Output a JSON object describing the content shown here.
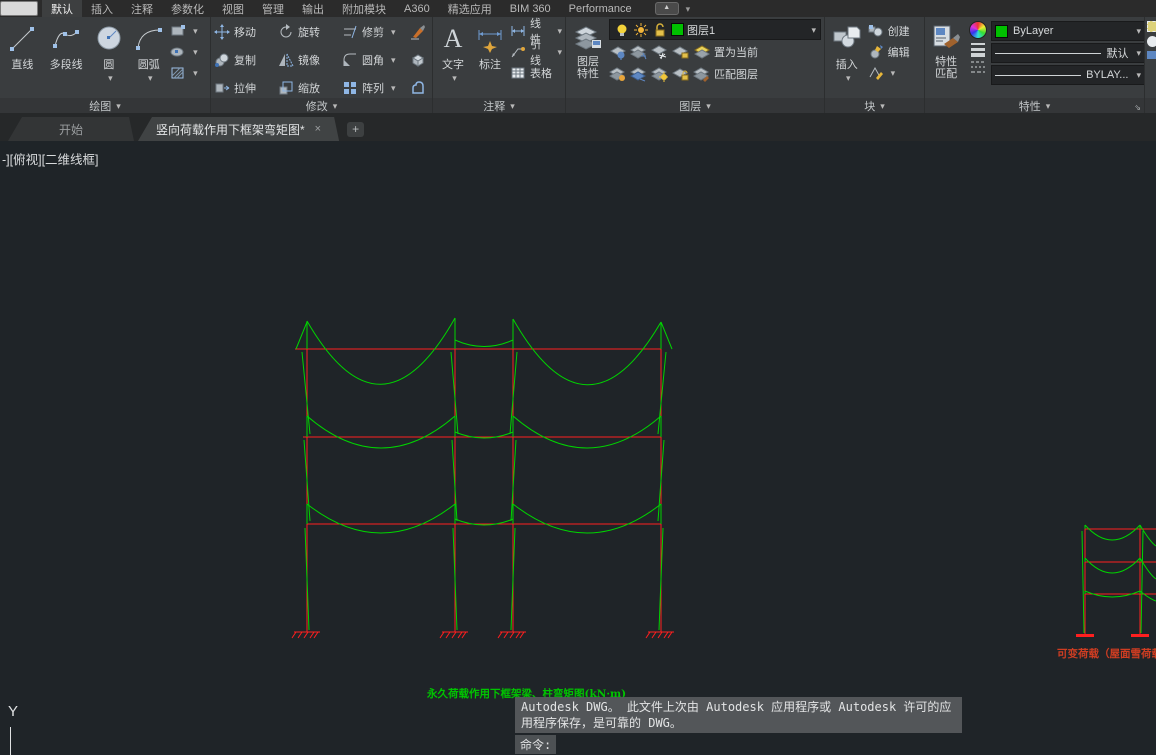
{
  "colors": {
    "canvas_bg": "#1f2428",
    "frame_red": "#ff1f1f",
    "moment_green": "#00d400",
    "bylayer_green": "#00c000",
    "caption_green": "#00c400",
    "caption_red": "#cf3d22"
  },
  "menu": {
    "tabs": [
      "默认",
      "插入",
      "注释",
      "参数化",
      "视图",
      "管理",
      "输出",
      "附加模块",
      "A360",
      "精选应用",
      "BIM 360",
      "Performance"
    ]
  },
  "ribbon": {
    "draw": {
      "title": "绘图",
      "line": "直线",
      "polyline": "多段线",
      "circle": "圆",
      "arc": "圆弧"
    },
    "modify": {
      "title": "修改",
      "move": "移动",
      "rotate": "旋转",
      "trim": "修剪",
      "copy": "复制",
      "mirror": "镜像",
      "fillet": "圆角",
      "stretch": "拉伸",
      "scale": "缩放",
      "array": "阵列"
    },
    "annotation": {
      "title": "注释",
      "text": "文字",
      "dimension": "标注",
      "linear": "线性",
      "leader": "引线",
      "table": "表格"
    },
    "layers": {
      "title": "图层",
      "properties_line1": "图层",
      "properties_line2": "特性",
      "current_layer": "图层1",
      "set_current": "置为当前",
      "match_layer": "匹配图层"
    },
    "block": {
      "title": "块",
      "insert": "插入",
      "create": "创建",
      "edit": "编辑"
    },
    "properties": {
      "title": "特性",
      "match_line1": "特性",
      "match_line2": "匹配",
      "color": "ByLayer",
      "lineweight": "默认",
      "linetype": "BYLAY..."
    }
  },
  "file_tabs": {
    "start": "开始",
    "document": "竖向荷载作用下框架弯矩图*",
    "close": "×",
    "new_tab": "+"
  },
  "viewport": {
    "controls": "-][俯视][二维线框]"
  },
  "drawing": {
    "caption_main": "永久荷载作用下框架梁、柱弯矩图(kN·m)",
    "caption_secondary": "可变荷载（屋面雪荷载）作用",
    "ucs_y_label": "Y"
  },
  "command": {
    "history_lines": [
      "Autodesk DWG。  此文件上次由 Autodesk 应用程序或 Autodesk 许可的应",
      "用程序保存，是可靠的 DWG。"
    ],
    "prompt": "命令:"
  }
}
